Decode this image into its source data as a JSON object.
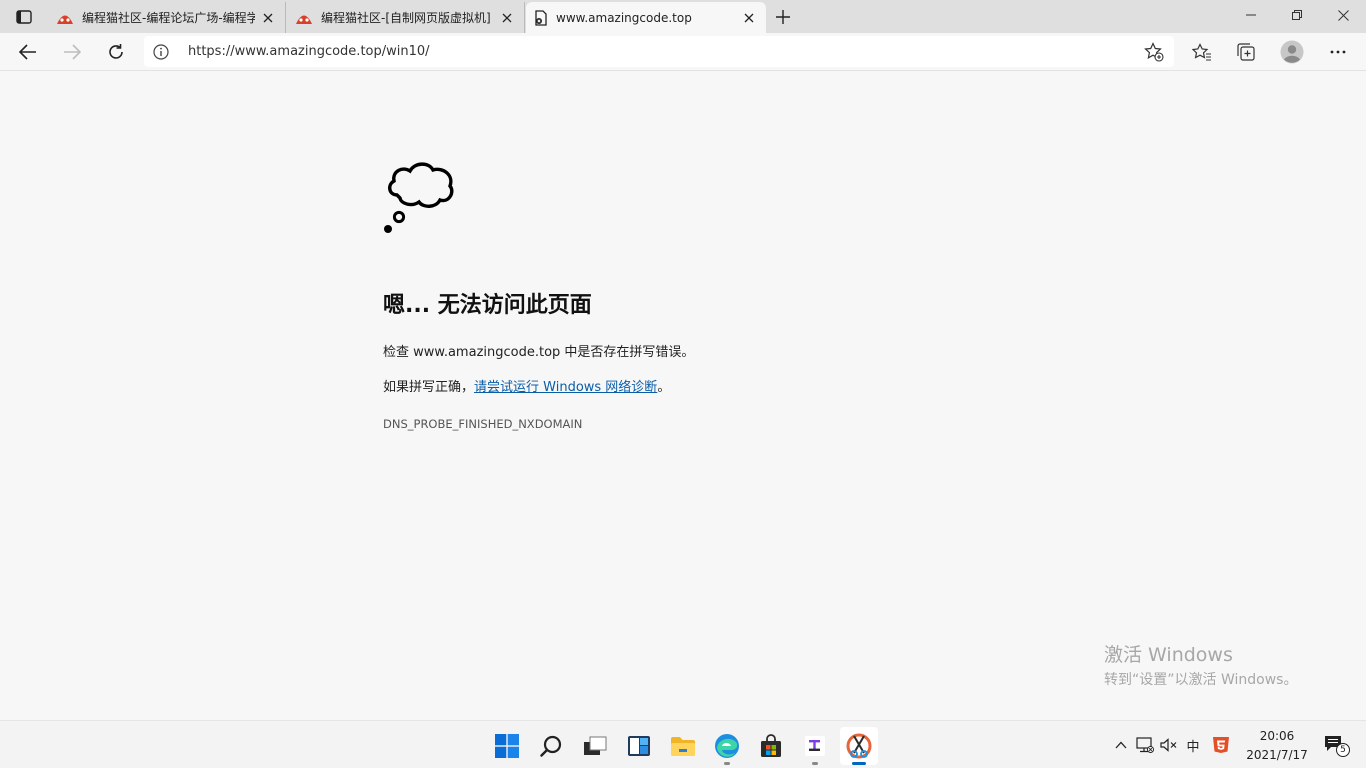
{
  "tabs": [
    {
      "title": "编程猫社区-编程论坛广场-编程学",
      "active": false
    },
    {
      "title": "编程猫社区-[自制网页版虚拟机]",
      "active": false
    },
    {
      "title": "www.amazingcode.top",
      "active": true
    }
  ],
  "address": {
    "url": "https://www.amazingcode.top/win10/"
  },
  "error": {
    "title": "嗯... 无法访问此页面",
    "line1": "检查 www.amazingcode.top 中是否存在拼写错误。",
    "line2_prefix": "如果拼写正确，",
    "line2_link": "请尝试运行 Windows 网络诊断",
    "line2_suffix": "。",
    "code": "DNS_PROBE_FINISHED_NXDOMAIN"
  },
  "watermark": {
    "line1": "激活 Windows",
    "line2": "转到“设置”以激活 Windows。"
  },
  "taskbar": {
    "ime": "中",
    "notification_count": "5",
    "time": "20:06",
    "date": "2021/7/17"
  },
  "colors": {
    "link": "#0a5ea8",
    "taskbar_accent": "#0067c0"
  }
}
